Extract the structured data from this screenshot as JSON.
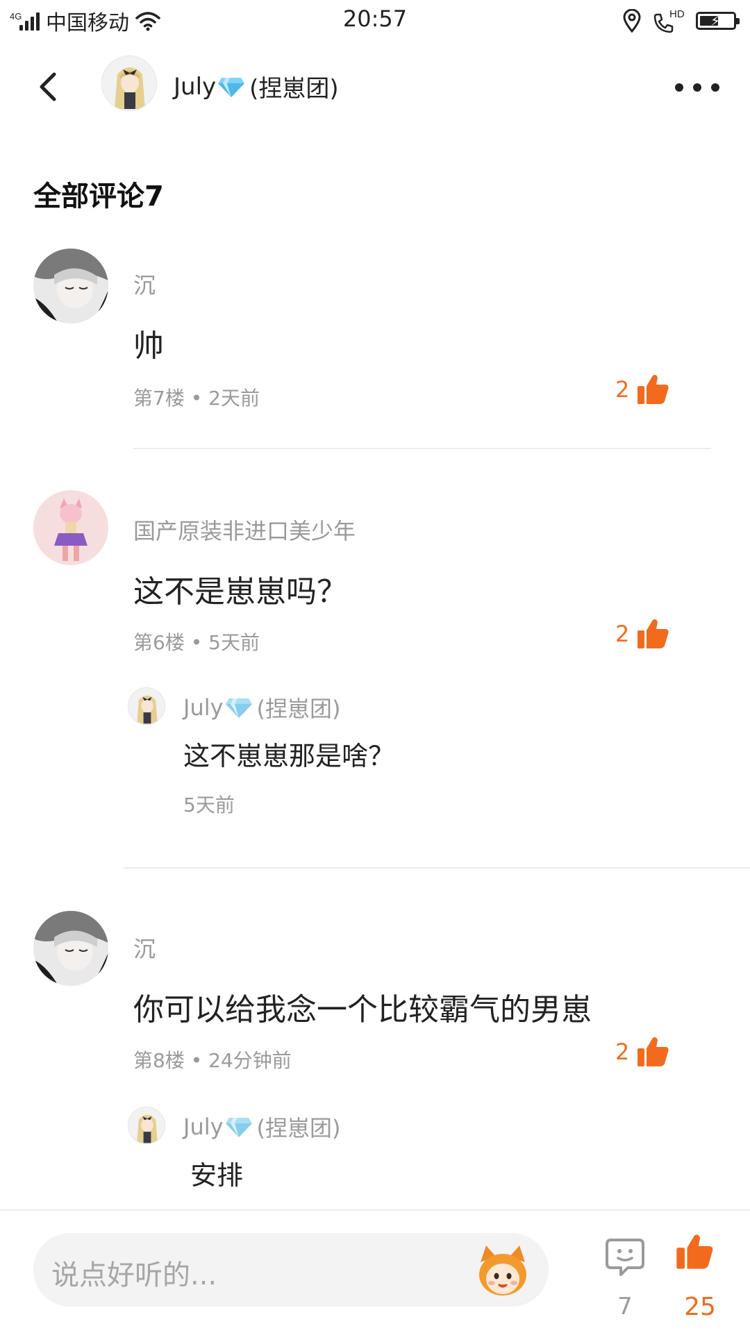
{
  "status_bar": {
    "network": "4G",
    "carrier": "中国移动",
    "time": "20:57",
    "hd_label": "HD"
  },
  "header": {
    "user_name": "July",
    "group_tag": "(捏崽团)",
    "icons": [
      "back-arrow-icon",
      "diamond-icon",
      "more-dots-icon"
    ]
  },
  "section": {
    "title": "全部评论7"
  },
  "comments": [
    {
      "author": "沉",
      "text": "帅",
      "meta": "第7楼 • 2天前",
      "likes": "2"
    },
    {
      "author": "国产原装非进口美少年",
      "text": "这不是崽崽吗？",
      "meta": "第6楼 • 5天前",
      "likes": "2",
      "reply": {
        "author": "July",
        "group_tag": "(捏崽团)",
        "text": "这不崽崽那是啥？",
        "meta": "5天前"
      }
    },
    {
      "author": "沉",
      "text": "你可以给我念一个比较霸气的男崽",
      "meta": "第8楼 • 24分钟前",
      "likes": "2",
      "reply": {
        "author": "July",
        "group_tag": "(捏崽团)",
        "text": "安排"
      }
    }
  ],
  "bottom_bar": {
    "placeholder": "说点好听的...",
    "comment_count": "7",
    "like_count": "25"
  },
  "colors": {
    "accent": "#f26b1d",
    "muted_text": "#9a9a9a",
    "diamond": "#6cc7f2"
  }
}
